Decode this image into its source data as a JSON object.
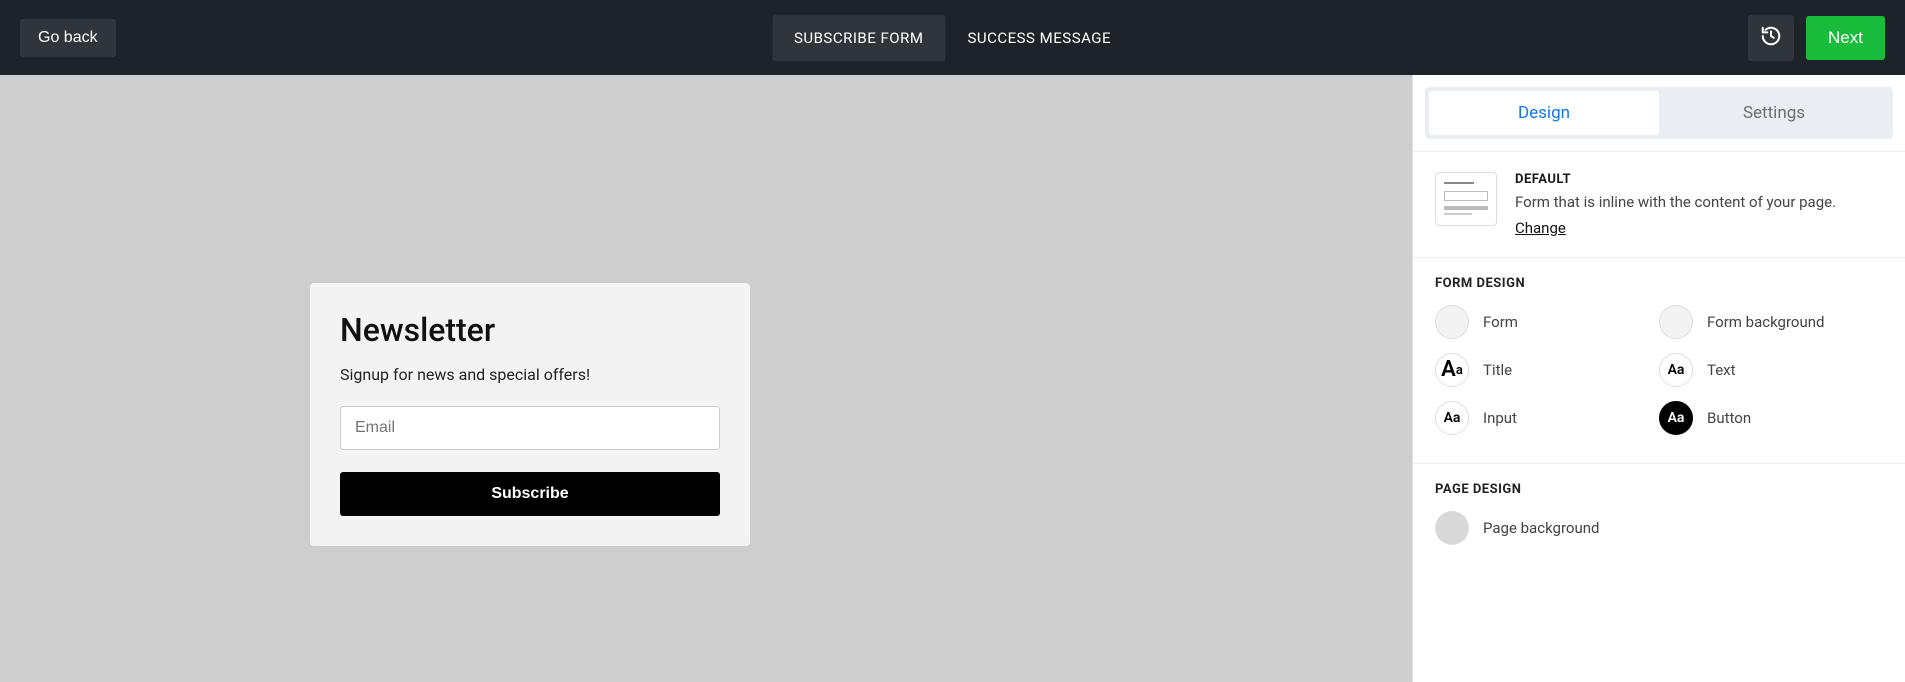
{
  "topbar": {
    "go_back": "Go back",
    "tabs": {
      "subscribe": "SUBSCRIBE FORM",
      "success": "SUCCESS MESSAGE"
    },
    "next": "Next"
  },
  "form": {
    "title": "Newsletter",
    "subtitle": "Signup for news and special offers!",
    "email_placeholder": "Email",
    "subscribe": "Subscribe"
  },
  "sidebar": {
    "tabs": {
      "design": "Design",
      "settings": "Settings"
    },
    "layout": {
      "name": "DEFAULT",
      "description": "Form that is inline with the content of your page.",
      "change": "Change"
    },
    "form_design_heading": "FORM DESIGN",
    "items": {
      "form": "Form",
      "form_bg": "Form background",
      "title": "Title",
      "text": "Text",
      "input": "Input",
      "button": "Button"
    },
    "page_design_heading": "PAGE DESIGN",
    "page_bg": "Page background"
  }
}
